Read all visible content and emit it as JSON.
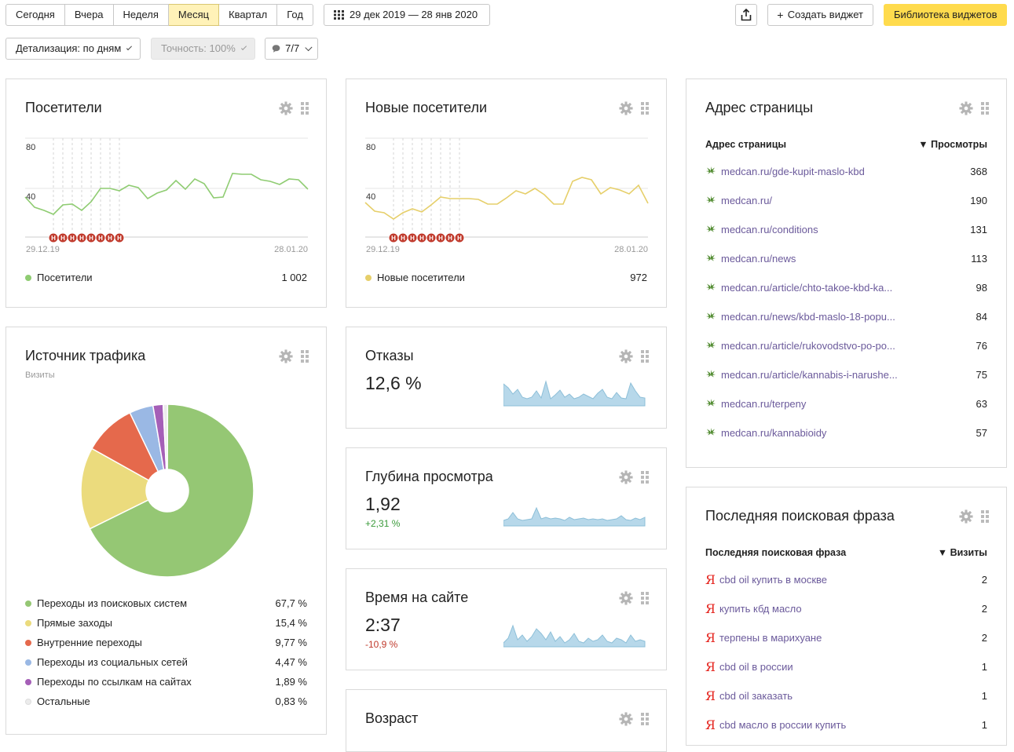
{
  "toolbar": {
    "periods": [
      "Сегодня",
      "Вчера",
      "Неделя",
      "Месяц",
      "Квартал",
      "Год"
    ],
    "active_period": "Месяц",
    "date_range": "29 дек 2019 — 28 янв 2020",
    "share_icon": "share-icon",
    "create_widget": "Создать виджет",
    "widget_library": "Библиотека виджетов",
    "detail": "Детализация: по дням",
    "accuracy": "Точность: 100%",
    "comments": "7/7"
  },
  "visitors": {
    "title": "Посетители",
    "y_ticks": [
      "80",
      "40"
    ],
    "x_start": "29.12.19",
    "x_end": "28.01.20",
    "legend": "Посетители",
    "total": "1 002",
    "color": "#8fcc72"
  },
  "new_visitors": {
    "title": "Новые посетители",
    "y_ticks": [
      "80",
      "40"
    ],
    "x_start": "29.12.19",
    "x_end": "28.01.20",
    "legend": "Новые посетители",
    "total": "972",
    "color": "#e6cf6a"
  },
  "holiday_marker": "Н",
  "traffic": {
    "title": "Источник трафика",
    "subtitle": "Визиты",
    "items": [
      {
        "label": "Переходы из поисковых систем",
        "value": "67,7 %",
        "color": "#95c774"
      },
      {
        "label": "Прямые заходы",
        "value": "15,4 %",
        "color": "#ebdb7d"
      },
      {
        "label": "Внутренние переходы",
        "value": "9,77 %",
        "color": "#e5694c"
      },
      {
        "label": "Переходы из социальных сетей",
        "value": "4,47 %",
        "color": "#9ab8e4"
      },
      {
        "label": "Переходы по ссылкам на сайтах",
        "value": "1,89 %",
        "color": "#a55fb7"
      },
      {
        "label": "Остальные",
        "value": "0,83 %",
        "color": "#ececec"
      }
    ]
  },
  "bounce": {
    "title": "Отказы",
    "value": "12,6 %"
  },
  "depth": {
    "title": "Глубина просмотра",
    "value": "1,92",
    "delta": "+2,31 %"
  },
  "time": {
    "title": "Время на сайте",
    "value": "2:37",
    "delta": "-10,9 %"
  },
  "age": {
    "title": "Возраст"
  },
  "pages": {
    "title": "Адрес страницы",
    "col1": "Адрес страницы",
    "col2": "▼ Просмотры",
    "rows": [
      {
        "url": "medcan.ru/gde-kupit-maslo-kbd",
        "views": "368"
      },
      {
        "url": "medcan.ru/",
        "views": "190"
      },
      {
        "url": "medcan.ru/conditions",
        "views": "131"
      },
      {
        "url": "medcan.ru/news",
        "views": "113"
      },
      {
        "url": "medcan.ru/article/chto-takoe-kbd-ka...",
        "views": "98"
      },
      {
        "url": "medcan.ru/news/kbd-maslo-18-popu...",
        "views": "84"
      },
      {
        "url": "medcan.ru/article/rukovodstvo-po-po...",
        "views": "76"
      },
      {
        "url": "medcan.ru/article/kannabis-i-narushe...",
        "views": "75"
      },
      {
        "url": "medcan.ru/terpeny",
        "views": "63"
      },
      {
        "url": "medcan.ru/kannabioidy",
        "views": "57"
      }
    ]
  },
  "search": {
    "title": "Последняя поисковая фраза",
    "col1": "Последняя поисковая фраза",
    "col2": "▼ Визиты",
    "rows": [
      {
        "phrase": "cbd oil купить в москве",
        "visits": "2"
      },
      {
        "phrase": "купить кбд масло",
        "visits": "2"
      },
      {
        "phrase": "терпены в марихуане",
        "visits": "2"
      },
      {
        "phrase": "cbd oil в россии",
        "visits": "1"
      },
      {
        "phrase": "cbd oil заказать",
        "visits": "1"
      },
      {
        "phrase": "cbd масло в россии купить",
        "visits": "1"
      }
    ]
  }
}
